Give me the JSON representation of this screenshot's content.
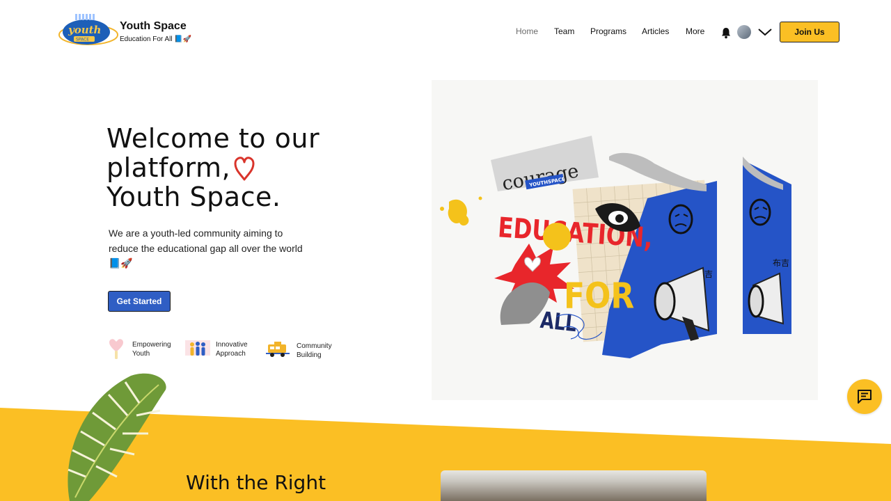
{
  "header": {
    "brand_title": "Youth Space",
    "brand_subtitle": "Education For All 📘🚀",
    "logo_text": "youth",
    "logo_subtext": "SPACE",
    "nav": [
      "Home",
      "Team",
      "Programs",
      "Articles",
      "More"
    ],
    "active_nav": "Home",
    "join_label": "Join Us"
  },
  "hero": {
    "title_line1": "Welcome to our",
    "title_line2": "platform,",
    "title_line3": "Youth Space.",
    "description": "We are a youth-led community aiming to reduce the educational gap all over the world📘🚀",
    "cta_label": "Get Started",
    "features": [
      {
        "line1": "Empowering",
        "line2": "Youth",
        "icon": "heart-hand-icon"
      },
      {
        "line1": "Innovative",
        "line2": "Approach",
        "icon": "people-icon"
      },
      {
        "line1": "Community",
        "line2": "Building",
        "icon": "bus-icon"
      }
    ]
  },
  "collage": {
    "courage": "courage",
    "youthspace": "YOUTHSPACE",
    "education": "EDUCATION,",
    "for": "FOR",
    "all": "ALL",
    "cjk": "布吉"
  },
  "section2": {
    "title": "With the Right"
  },
  "colors": {
    "accent_yellow": "#fbbf24",
    "accent_blue": "#2f5ec4",
    "collage_blue": "#2554c7",
    "collage_red": "#e8262b"
  }
}
